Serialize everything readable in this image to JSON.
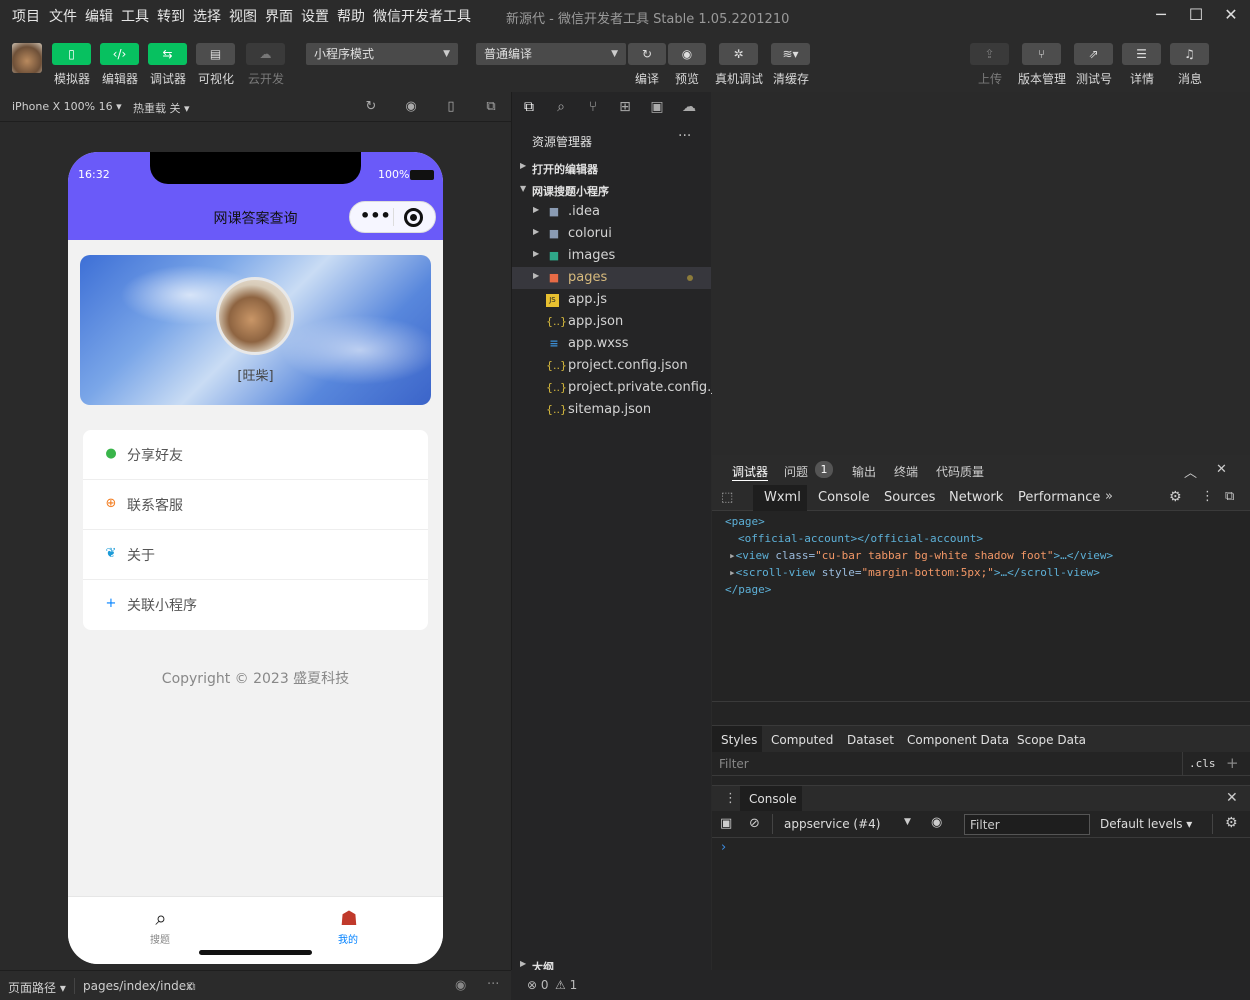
{
  "app": {
    "window_title": "新源代 - 微信开发者工具 Stable 1.05.2201210",
    "menu": [
      "项目",
      "文件",
      "编辑",
      "工具",
      "转到",
      "选择",
      "视图",
      "界面",
      "设置",
      "帮助",
      "微信开发者工具"
    ]
  },
  "toolbar": {
    "simulator": "模拟器",
    "editor": "编辑器",
    "debugger": "调试器",
    "visual": "可视化",
    "cloud": "云开发",
    "mode_select": "小程序模式",
    "compile_select": "普通编译",
    "compile": "编译",
    "preview": "预览",
    "remote_debug": "真机调试",
    "clear_cache": "清缓存",
    "upload": "上传",
    "version": "版本管理",
    "test_account": "测试号",
    "details": "详情",
    "messages": "消息"
  },
  "devbar": {
    "device": "iPhone X 100% 16",
    "hot_reload": "热重载 关"
  },
  "phone": {
    "time": "16:32",
    "battery": "100%",
    "nav_title": "网课答案查询",
    "username": "[旺柴]",
    "menu_items": [
      {
        "label": "分享好友",
        "icon": "lightbulb-icon",
        "color": "#39b54a"
      },
      {
        "label": "联系客服",
        "icon": "plus-circle-icon",
        "color": "#f37b1d"
      },
      {
        "label": "关于",
        "icon": "wechat-icon",
        "color": "#1cbbb4"
      },
      {
        "label": "关联小程序",
        "icon": "plus-icon",
        "color": "#0081ff"
      }
    ],
    "copyright": "Copyright  ©  2023  盛夏科技",
    "tabs": [
      {
        "label": "搜题",
        "icon": "search-icon",
        "active": false
      },
      {
        "label": "我的",
        "icon": "reader-icon",
        "active": true
      }
    ],
    "accent_color": "#6a5af9"
  },
  "sim_footer": {
    "path_label": "页面路径",
    "path": "pages/index/index"
  },
  "explorer": {
    "title": "资源管理器",
    "open_editors": "打开的编辑器",
    "project": "网课搜题小程序",
    "files": [
      {
        "name": ".idea",
        "type": "folder"
      },
      {
        "name": "colorui",
        "type": "folder"
      },
      {
        "name": "images",
        "type": "folder"
      },
      {
        "name": "pages",
        "type": "folder"
      },
      {
        "name": "app.js",
        "type": "js"
      },
      {
        "name": "app.json",
        "type": "json"
      },
      {
        "name": "app.wxss",
        "type": "wxss"
      },
      {
        "name": "project.config.json",
        "type": "json"
      },
      {
        "name": "project.private.config.js...",
        "type": "json"
      },
      {
        "name": "sitemap.json",
        "type": "json"
      }
    ],
    "outline": "大纲"
  },
  "debugger": {
    "tabs": [
      "调试器",
      "问题",
      "输出",
      "终端",
      "代码质量"
    ],
    "issue_count": "1",
    "devtools_tabs": [
      "Wxml",
      "Console",
      "Sources",
      "Network",
      "Performance"
    ],
    "wxml": {
      "l1": "<page>",
      "l2": "<official-account></official-account>",
      "l3_tag": "<view ",
      "l3_attr": "class=",
      "l3_val": "\"cu-bar tabbar bg-white shadow foot\"",
      "l3_end": ">…</view>",
      "l4_tag": "<scroll-view ",
      "l4_attr": "style=",
      "l4_val": "\"margin-bottom:5px;\"",
      "l4_end": ">…</scroll-view>",
      "l5": "</page>"
    },
    "styles_tabs": [
      "Styles",
      "Computed",
      "Dataset",
      "Component Data",
      "Scope Data"
    ],
    "filter_placeholder": "Filter",
    "cls": ".cls",
    "console_title": "Console",
    "context": "appservice (#4)",
    "console_filter": "Filter",
    "levels": "Default levels"
  },
  "statusbar": {
    "errors": "0",
    "warnings": "1"
  }
}
